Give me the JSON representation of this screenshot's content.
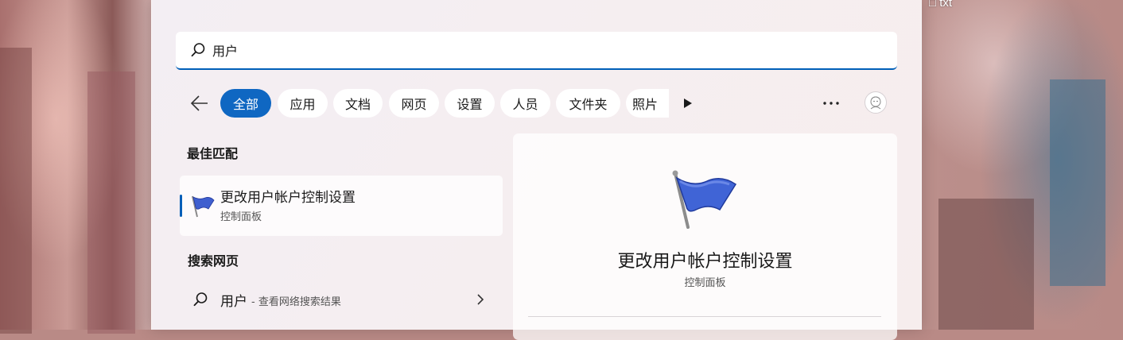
{
  "desktop": {
    "label": "txt"
  },
  "search": {
    "value": "用户",
    "placeholder": ""
  },
  "filters": [
    "全部",
    "应用",
    "文档",
    "网页",
    "设置",
    "人员",
    "文件夹",
    "照片"
  ],
  "colors": {
    "accent": "#005fb8",
    "active_chip": "#0f67c2"
  },
  "icons": {
    "search": "search-icon",
    "back": "back-arrow-icon",
    "play": "play-icon",
    "more": "more-icon",
    "avatar": "avatar-icon",
    "flag": "flag-icon",
    "chevron": "chevron-right-icon"
  },
  "best_match": {
    "title": "最佳匹配",
    "item": {
      "name": "更改用户帐户控制设置",
      "category": "控制面板"
    }
  },
  "web": {
    "title": "搜索网页",
    "query": "用户",
    "hint": "- 查看网络搜索结果"
  },
  "detail": {
    "title": "更改用户帐户控制设置",
    "subtitle": "控制面板"
  }
}
